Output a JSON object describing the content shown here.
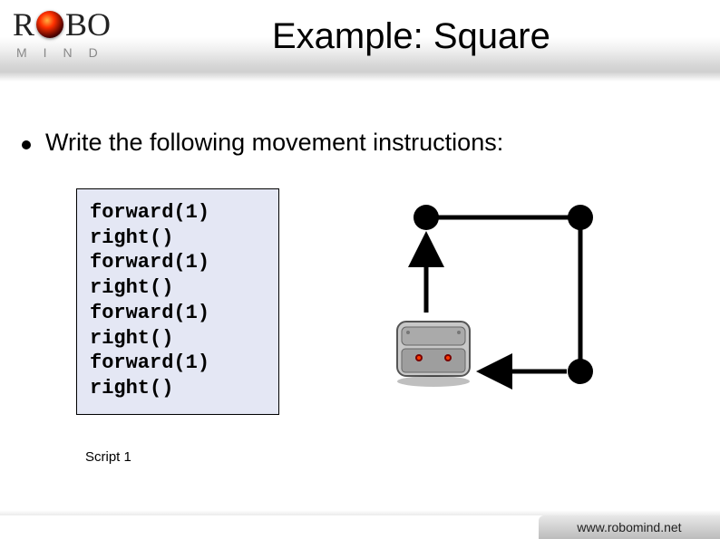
{
  "logo": {
    "top_left": "R",
    "top_right": "BO",
    "sub": "MIND"
  },
  "title": "Example: Square",
  "instruction": "Write the following movement instructions:",
  "code_lines": [
    "forward(1)",
    "right()",
    "forward(1)",
    "right()",
    "forward(1)",
    "right()",
    "forward(1)",
    "right()"
  ],
  "script_label": "Script 1",
  "footer": "www.robomind.net"
}
